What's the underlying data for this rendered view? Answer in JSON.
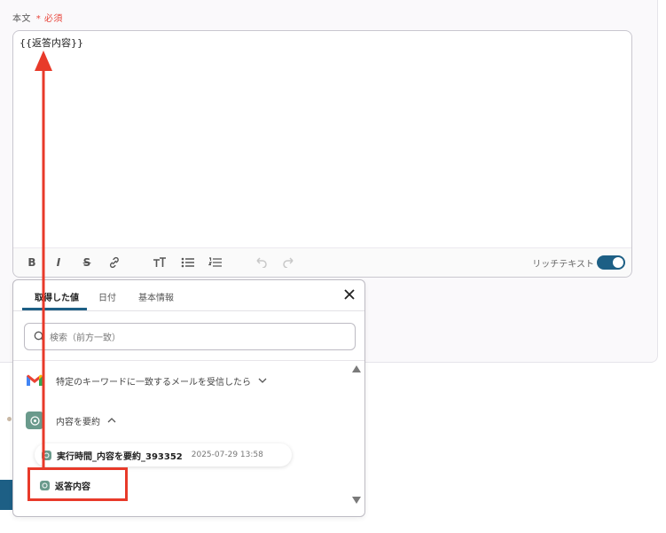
{
  "field": {
    "label": "本文",
    "required_mark": "*",
    "required_text": "必須",
    "value": "{{返答内容}}"
  },
  "toolbar": {
    "bold_label": "B",
    "italic_label": "I",
    "strike_label": "S",
    "rich_text_label": "リッチテキスト",
    "rich_text_enabled": true
  },
  "popup": {
    "tabs": [
      "取得した値",
      "日付",
      "基本情報"
    ],
    "active_tab": "取得した値",
    "search_placeholder": "検索（前方一致）",
    "items": [
      {
        "label": "特定のキーワードに一致するメールを受信したら",
        "icon": "gmail-icon",
        "expanded": false
      },
      {
        "label": "内容を要約",
        "icon": "chatgpt-icon",
        "expanded": true
      }
    ],
    "result": {
      "name": "実行時間_内容を要約_393352",
      "time": "2025-07-29 13:58"
    },
    "answer": "返答内容"
  },
  "colors": {
    "accent": "#1d5f85",
    "highlight": "#e83a2a",
    "required": "#e8473d"
  }
}
